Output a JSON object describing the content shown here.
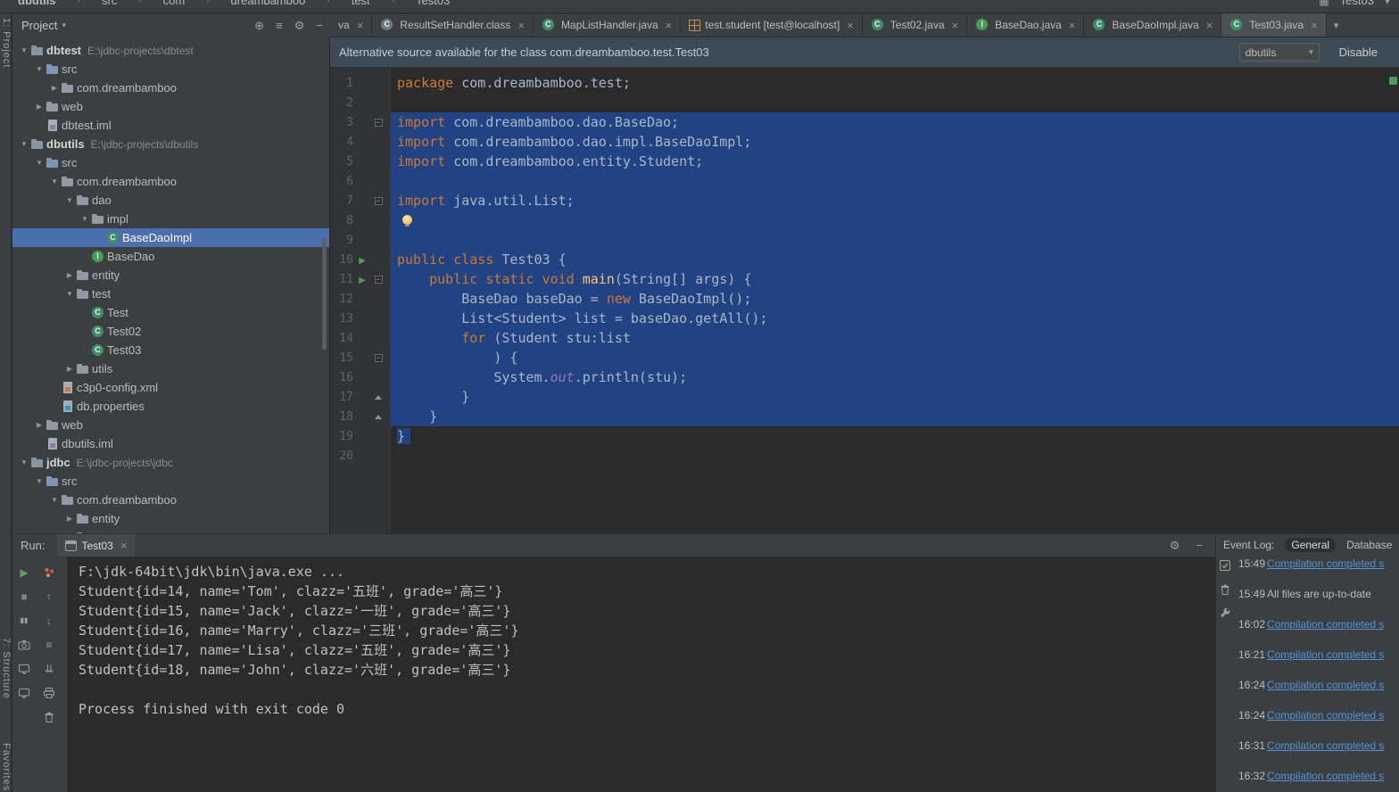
{
  "top_strip": {
    "breadcrumbs": [
      "dbutils",
      "src",
      "com",
      "dreambamboo",
      "test",
      "Test03"
    ],
    "right_icon_glyph": "▦",
    "run_config": "Test03"
  },
  "tool_buttons": [
    "1: Project",
    "7: Structure",
    "Favorites"
  ],
  "project_panel": {
    "title": "Project",
    "header_icons": [
      {
        "name": "locate",
        "glyph": "⊕"
      },
      {
        "name": "view-options",
        "glyph": "≡"
      },
      {
        "name": "settings-gear",
        "glyph": "⚙"
      },
      {
        "name": "hide-panel",
        "glyph": "−"
      }
    ],
    "tree": [
      {
        "indent": 0,
        "expand": "down",
        "icon": "project",
        "label": "dbtest",
        "path": "E:\\jdbc-projects\\dbtest",
        "bold": true
      },
      {
        "indent": 1,
        "expand": "down",
        "icon": "folder-src",
        "label": "src"
      },
      {
        "indent": 2,
        "expand": "right",
        "icon": "folder",
        "label": "com.dreambamboo"
      },
      {
        "indent": 1,
        "expand": "right",
        "icon": "folder-web",
        "label": "web"
      },
      {
        "indent": 1,
        "icon": "iml",
        "label": "dbtest.iml"
      },
      {
        "indent": 0,
        "expand": "down",
        "icon": "project",
        "label": "dbutils",
        "path": "E:\\jdbc-projects\\dbutils",
        "bold": true
      },
      {
        "indent": 1,
        "expand": "down",
        "icon": "folder-src",
        "label": "src"
      },
      {
        "indent": 2,
        "expand": "down",
        "icon": "folder",
        "label": "com.dreambamboo"
      },
      {
        "indent": 3,
        "expand": "down",
        "icon": "folder",
        "label": "dao"
      },
      {
        "indent": 4,
        "expand": "down",
        "icon": "folder",
        "label": "impl"
      },
      {
        "indent": 5,
        "icon": "class",
        "label": "BaseDaoImpl",
        "selected": true
      },
      {
        "indent": 4,
        "icon": "interface",
        "label": "BaseDao"
      },
      {
        "indent": 3,
        "expand": "right",
        "icon": "folder",
        "label": "entity"
      },
      {
        "indent": 3,
        "expand": "down",
        "icon": "folder",
        "label": "test"
      },
      {
        "indent": 4,
        "icon": "class",
        "label": "Test"
      },
      {
        "indent": 4,
        "icon": "class",
        "label": "Test02"
      },
      {
        "indent": 4,
        "icon": "class",
        "label": "Test03"
      },
      {
        "indent": 3,
        "expand": "right",
        "icon": "folder",
        "label": "utils"
      },
      {
        "indent": 2,
        "icon": "xml",
        "label": "c3p0-config.xml"
      },
      {
        "indent": 2,
        "icon": "properties",
        "label": "db.properties"
      },
      {
        "indent": 1,
        "expand": "right",
        "icon": "folder-web",
        "label": "web"
      },
      {
        "indent": 1,
        "icon": "iml",
        "label": "dbutils.iml"
      },
      {
        "indent": 0,
        "expand": "down",
        "icon": "project",
        "label": "jdbc",
        "path": "E:\\jdbc-projects\\jdbc",
        "bold": true
      },
      {
        "indent": 1,
        "expand": "down",
        "icon": "folder-src",
        "label": "src"
      },
      {
        "indent": 2,
        "expand": "down",
        "icon": "folder",
        "label": "com.dreambamboo"
      },
      {
        "indent": 3,
        "expand": "right",
        "icon": "folder",
        "label": "entity"
      },
      {
        "indent": 3,
        "expand": "right",
        "icon": "folder",
        "label": "test"
      }
    ]
  },
  "tabs": {
    "items": [
      {
        "label": "va",
        "icon": null
      },
      {
        "label": "ResultSetHandler.class",
        "icon": "classfile"
      },
      {
        "label": "MapListHandler.java",
        "icon": "class"
      },
      {
        "label": "test.student [test@localhost]",
        "icon": "table"
      },
      {
        "label": "Test02.java",
        "icon": "class"
      },
      {
        "label": "BaseDao.java",
        "icon": "interface"
      },
      {
        "label": "BaseDaoImpl.java",
        "icon": "class"
      },
      {
        "label": "Test03.java",
        "icon": "class",
        "selected": true
      }
    ],
    "overflow_chevron": "▾"
  },
  "banner": {
    "text": "Alternative source available for the class com.dreambamboo.test.Test03",
    "combo_value": "dbutils",
    "action": "Disable"
  },
  "editor": {
    "lines": [
      {
        "num": 1,
        "seg": [
          {
            "c": "kw",
            "t": "package"
          },
          {
            "c": "plain",
            "t": " com.dreambamboo.test;"
          }
        ]
      },
      {
        "num": 2,
        "seg": []
      },
      {
        "num": 3,
        "sel": "full",
        "fold": "minus",
        "seg": [
          {
            "c": "kw",
            "t": "import"
          },
          {
            "c": "plain",
            "t": " com.dreambamboo.dao.BaseDao;"
          }
        ]
      },
      {
        "num": 4,
        "sel": "full",
        "seg": [
          {
            "c": "kw",
            "t": "import"
          },
          {
            "c": "plain",
            "t": " com.dreambamboo.dao.impl.BaseDaoImpl;"
          }
        ]
      },
      {
        "num": 5,
        "sel": "full",
        "seg": [
          {
            "c": "kw",
            "t": "import"
          },
          {
            "c": "plain",
            "t": " com.dreambamboo.entity.Student;"
          }
        ]
      },
      {
        "num": 6,
        "sel": "full",
        "seg": []
      },
      {
        "num": 7,
        "sel": "full",
        "fold": "minus",
        "seg": [
          {
            "c": "kw",
            "t": "import"
          },
          {
            "c": "plain",
            "t": " java.util.List;"
          }
        ]
      },
      {
        "num": 8,
        "sel": "full",
        "bulb": true,
        "seg": []
      },
      {
        "num": 9,
        "sel": "full",
        "seg": []
      },
      {
        "num": 10,
        "sel": "full",
        "run": true,
        "seg": [
          {
            "c": "kw",
            "t": "public class"
          },
          {
            "c": "plain",
            "t": " Test03 {"
          }
        ]
      },
      {
        "num": 11,
        "sel": "full",
        "run": true,
        "fold": "minus",
        "seg": [
          {
            "c": "plain",
            "t": "    "
          },
          {
            "c": "kw",
            "t": "public static void"
          },
          {
            "c": "plain",
            "t": " "
          },
          {
            "c": "method",
            "t": "main"
          },
          {
            "c": "plain",
            "t": "(String[] args) {"
          }
        ]
      },
      {
        "num": 12,
        "sel": "full",
        "seg": [
          {
            "c": "plain",
            "t": "        BaseDao baseDao = "
          },
          {
            "c": "kw",
            "t": "new"
          },
          {
            "c": "plain",
            "t": " BaseDaoImpl();"
          }
        ]
      },
      {
        "num": 13,
        "sel": "full",
        "seg": [
          {
            "c": "plain",
            "t": "        List<Student> list = baseDao.getAll();"
          }
        ]
      },
      {
        "num": 14,
        "sel": "full",
        "seg": [
          {
            "c": "plain",
            "t": "        "
          },
          {
            "c": "kw",
            "t": "for"
          },
          {
            "c": "plain",
            "t": " (Student stu:list"
          }
        ]
      },
      {
        "num": 15,
        "sel": "full",
        "fold": "minus",
        "seg": [
          {
            "c": "plain",
            "t": "            ) {"
          }
        ]
      },
      {
        "num": 16,
        "sel": "full",
        "seg": [
          {
            "c": "plain",
            "t": "            System."
          },
          {
            "c": "static",
            "t": "out"
          },
          {
            "c": "plain",
            "t": ".println(stu);"
          }
        ]
      },
      {
        "num": 17,
        "sel": "full",
        "fold": "end",
        "seg": [
          {
            "c": "plain",
            "t": "        }"
          }
        ]
      },
      {
        "num": 18,
        "sel": "full",
        "fold": "end",
        "seg": [
          {
            "c": "plain",
            "t": "    }"
          }
        ]
      },
      {
        "num": 19,
        "sel": "partial",
        "seg": [
          {
            "c": "plain",
            "t": "}"
          }
        ]
      },
      {
        "num": 20,
        "seg": []
      }
    ]
  },
  "run_panel": {
    "label": "Run:",
    "tab_title": "Test03",
    "header_icons": [
      {
        "name": "settings-gear",
        "glyph": "⚙"
      },
      {
        "name": "hide-panel",
        "glyph": "−"
      }
    ],
    "toolbar_left": [
      {
        "name": "rerun",
        "glyph": "▶",
        "color": "#5f9e61"
      },
      {
        "name": "stop",
        "glyph": "■",
        "color": "#7f8487"
      },
      {
        "name": "pause-output",
        "glyph": "▮▮",
        "color": "#9da0a3"
      },
      {
        "name": "screenshot",
        "shape": "camera"
      },
      {
        "name": "restore-layout",
        "shape": "monitor"
      },
      {
        "name": "pin-tab",
        "shape": "monitor"
      }
    ],
    "toolbar_right": [
      {
        "name": "rerun-failed",
        "shape": "dots"
      },
      {
        "name": "up-stack-trace",
        "glyph": "↑",
        "color": "#9da0a3"
      },
      {
        "name": "down-stack-trace",
        "glyph": "↓",
        "color": "#9da0a3"
      },
      {
        "name": "soft-wrap",
        "glyph": "≡",
        "color": "#9da0a3"
      },
      {
        "name": "scroll-to-end",
        "glyph": "⇊",
        "color": "#9da0a3"
      },
      {
        "name": "print",
        "shape": "printer"
      },
      {
        "name": "clear-all",
        "shape": "trash"
      }
    ],
    "console_lines": [
      "F:\\jdk-64bit\\jdk\\bin\\java.exe ...",
      "Student{id=14, name='Tom', clazz='五班', grade='高三'}",
      "Student{id=15, name='Jack', clazz='一班', grade='高三'}",
      "Student{id=16, name='Marry', clazz='三班', grade='高三'}",
      "Student{id=17, name='Lisa', clazz='五班', grade='高三'}",
      "Student{id=18, name='John', clazz='六班', grade='高三'}",
      "",
      "Process finished with exit code 0"
    ]
  },
  "event_log": {
    "title": "Event Log:",
    "tabs": [
      "General",
      "Database"
    ],
    "side_icons": [
      {
        "name": "mark-read",
        "shape": "checkbox"
      },
      {
        "name": "clear-log",
        "shape": "trash"
      },
      {
        "name": "event-log-settings",
        "shape": "wrench"
      }
    ],
    "entries": [
      {
        "time": "15:49",
        "text": "Compilation completed s",
        "link": true
      },
      {
        "time": "15:49",
        "text": "All files are up-to-date",
        "link": false
      },
      {
        "time": "16:02",
        "text": "Compilation completed s",
        "link": true
      },
      {
        "time": "16:21",
        "text": "Compilation completed s",
        "link": true
      },
      {
        "time": "16:24",
        "text": "Compilation completed s",
        "link": true
      },
      {
        "time": "16:24",
        "text": "Compilation completed s",
        "link": true
      },
      {
        "time": "16:31",
        "text": "Compilation completed s",
        "link": true
      },
      {
        "time": "16:32",
        "text": "Compilation completed s",
        "link": true
      }
    ]
  },
  "colors": {
    "editor_bg": "#2b2b2b",
    "panel_bg": "#3c3f41",
    "selection": "#214283",
    "tree_selection": "#4b6eaf",
    "keyword": "#cc7832",
    "link": "#5394d8",
    "run_green": "#4f9d55"
  }
}
